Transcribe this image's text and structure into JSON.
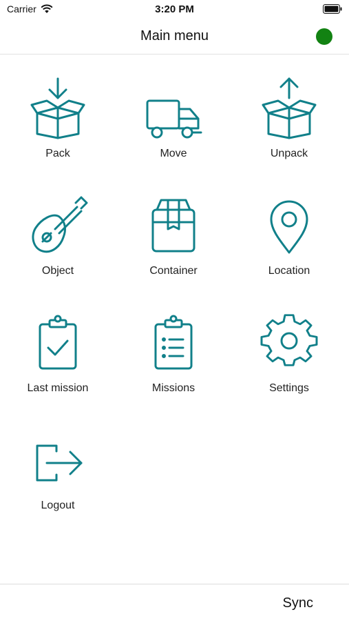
{
  "status_bar": {
    "carrier": "Carrier",
    "time": "3:20 PM",
    "wifi_icon": "wifi-icon",
    "battery_icon": "battery-icon"
  },
  "nav": {
    "title": "Main menu",
    "connection_status_color": "#128212"
  },
  "colors": {
    "accent": "#11808a",
    "text": "#222222"
  },
  "menu": [
    {
      "label": "Pack",
      "icon": "pack-box-down-icon"
    },
    {
      "label": "Move",
      "icon": "truck-icon"
    },
    {
      "label": "Unpack",
      "icon": "unpack-box-up-icon"
    },
    {
      "label": "Object",
      "icon": "guitar-icon"
    },
    {
      "label": "Container",
      "icon": "container-box-icon"
    },
    {
      "label": "Location",
      "icon": "location-pin-icon"
    },
    {
      "label": "Last mission",
      "icon": "clipboard-check-icon"
    },
    {
      "label": "Missions",
      "icon": "clipboard-list-icon"
    },
    {
      "label": "Settings",
      "icon": "gear-icon"
    },
    {
      "label": "Logout",
      "icon": "logout-icon"
    }
  ],
  "toolbar": {
    "sync_label": "Sync"
  }
}
